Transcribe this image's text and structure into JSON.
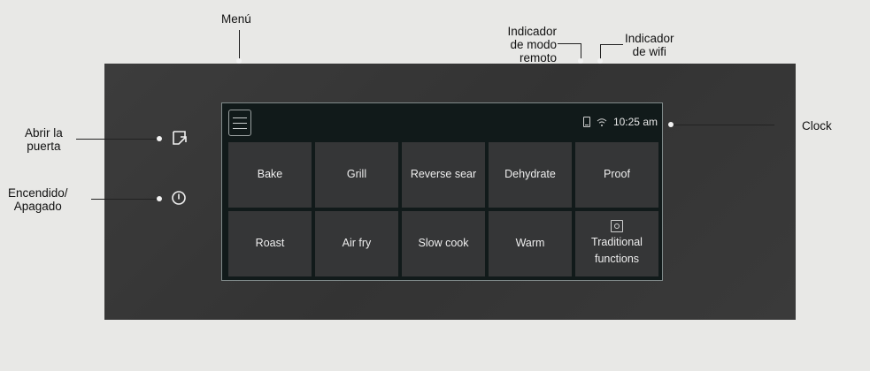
{
  "annotations": {
    "menu": "Menú",
    "remote_mode": [
      "Indicador",
      "de modo",
      "remoto"
    ],
    "wifi": [
      "Indicador",
      "de wifi"
    ],
    "open_door": [
      "Abrir la",
      "puerta"
    ],
    "power": [
      "Encendido/",
      "Apagado"
    ],
    "clock": "Clock"
  },
  "status": {
    "time": "10:25 am",
    "remote_icon": "phone-icon",
    "wifi_icon": "wifi-icon"
  },
  "controls": {
    "open_door_icon": "door-open-icon",
    "power_icon": "power-icon"
  },
  "tiles": [
    {
      "label": "Bake"
    },
    {
      "label": "Grill"
    },
    {
      "label": "Reverse sear"
    },
    {
      "label": "Dehydrate"
    },
    {
      "label": "Proof"
    },
    {
      "label": "Roast"
    },
    {
      "label": "Air fry"
    },
    {
      "label": "Slow cook"
    },
    {
      "label": "Warm"
    },
    {
      "label": "Traditional\nfunctions",
      "icon": "oven-fan-icon"
    }
  ]
}
